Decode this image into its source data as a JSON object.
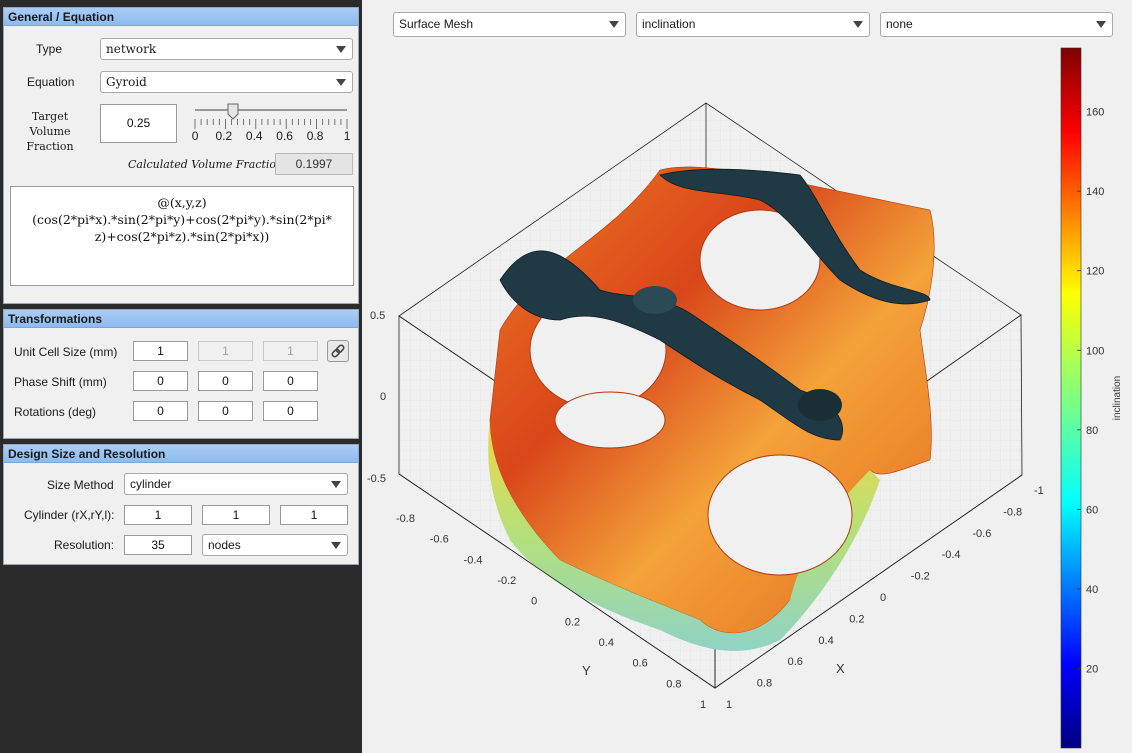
{
  "panels": {
    "general": {
      "title": "General / Equation",
      "type_label": "Type",
      "type_value": "network",
      "equation_label": "Equation",
      "equation_value": "Gyroid",
      "target_label_line1": "Target Volume",
      "target_label_line2": "Fraction",
      "target_value": "0.25",
      "slider_value": 0.25,
      "slider_ticks": [
        "0",
        "0.2",
        "0.4",
        "0.6",
        "0.8",
        "1"
      ],
      "calc_label": "Calculated Volume Fraction",
      "calc_value": "0.1997",
      "equation_text_line1": "@(x,y,z)",
      "equation_text_line2": "(cos(2*pi*x).*sin(2*pi*y)+cos(2*pi*y).*sin(2*pi*",
      "equation_text_line3": "z)+cos(2*pi*z).*sin(2*pi*x))"
    },
    "transformations": {
      "title": "Transformations",
      "unit_cell_label": "Unit Cell Size (mm)",
      "unit_cell_values": [
        "1",
        "1",
        "1"
      ],
      "phase_label": "Phase Shift (mm)",
      "phase_values": [
        "0",
        "0",
        "0"
      ],
      "rotations_label": "Rotations (deg)",
      "rotations_values": [
        "0",
        "0",
        "0"
      ]
    },
    "design": {
      "title": "Design Size and Resolution",
      "size_method_label": "Size Method",
      "size_method_value": "cylinder",
      "cylinder_label": "Cylinder (rX,rY,l):",
      "cylinder_values": [
        "1",
        "1",
        "1"
      ],
      "resolution_label": "Resolution:",
      "resolution_value": "35",
      "resolution_unit": "nodes"
    }
  },
  "view": {
    "dropdown1": "Surface Mesh",
    "dropdown2": "inclination",
    "dropdown3": "none"
  },
  "plot": {
    "z_ticks": [
      "0.5",
      "0",
      "-0.5"
    ],
    "y_ticks": [
      "-0.8",
      "-0.6",
      "-0.4",
      "-0.2",
      "0",
      "0.2",
      "0.4",
      "0.6",
      "0.8",
      "1"
    ],
    "x_ticks": [
      "-1",
      "-0.8",
      "-0.6",
      "-0.4",
      "-0.2",
      "0",
      "0.2",
      "0.4",
      "0.6",
      "0.8",
      "1"
    ],
    "y_label": "Y",
    "x_label": "X"
  },
  "colorbar": {
    "label": "inclination",
    "ticks": [
      "160",
      "140",
      "120",
      "100",
      "80",
      "60",
      "40",
      "20"
    ],
    "min": 0,
    "max": 176
  }
}
